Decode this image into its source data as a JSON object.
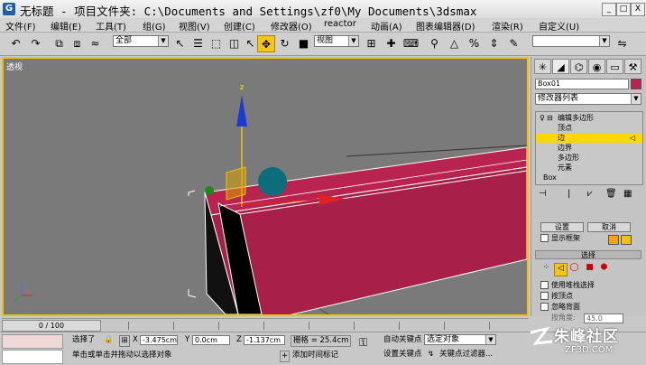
{
  "window": {
    "icon_letter": "G",
    "title": "无标题    - 项目文件夹: C:\\Documents and Settings\\zf0\\My Documents\\3dsmax",
    "minimize": "_",
    "maximize": "□",
    "close": "X"
  },
  "menu": [
    "文件(F)",
    "编辑(E)",
    "工具(T)",
    "组(G)",
    "视图(V)",
    "创建(C)",
    "修改器(O)",
    "reactor",
    "动画(A)",
    "图表编辑器(D)",
    "渲染(R)",
    "自定义(U)"
  ],
  "toolbar": {
    "selection_filter": "全部",
    "reference_coord": "视图"
  },
  "viewport": {
    "label": "透视"
  },
  "command_panel": {
    "object_name": "Box01",
    "modifier_list": "修改器列表",
    "stack": [
      {
        "label": "编辑多边形",
        "level": 0,
        "selected": false
      },
      {
        "label": "顶点",
        "level": 1,
        "selected": false
      },
      {
        "label": "边",
        "level": 1,
        "selected": true
      },
      {
        "label": "边界",
        "level": 1,
        "selected": false
      },
      {
        "label": "多边形",
        "level": 1,
        "selected": false
      },
      {
        "label": "元素",
        "level": 1,
        "selected": false
      },
      {
        "label": "Box",
        "level": 0,
        "selected": false
      }
    ],
    "settings_button": "设置",
    "cancel_button": "取消",
    "show_cage": "显示框架",
    "selection_rollout": "选择",
    "use_stack_selection": "使用堆栈选择",
    "by_vertex": "按顶点",
    "ignore_backfacing": "忽略背面",
    "by_angle": "按角度:",
    "angle_value": "45.0"
  },
  "timeline": {
    "frame_display": "0 / 100"
  },
  "status": {
    "selection": "选择了",
    "x_label": "X",
    "x_value": "-3.475cm",
    "y_label": "Y",
    "y_value": "0.0cm",
    "z_label": "Z",
    "z_value": "-1.137cm",
    "grid": "栅格 = 25.4cm",
    "auto_key": "自动关键点",
    "selected_object": "选定对象",
    "set_key": "设置关键点",
    "key_filters": "关键点过滤器...",
    "prompt": "单击或单击并拖动以选择对象",
    "add_time_tag": "添加时间标记"
  },
  "watermark": {
    "text": "朱峰社区",
    "url": "ZF3D.COM"
  },
  "colors": {
    "accent": "#f2c200",
    "box_color": "#b8234f",
    "viewport_bg": "#7a7a7a"
  }
}
